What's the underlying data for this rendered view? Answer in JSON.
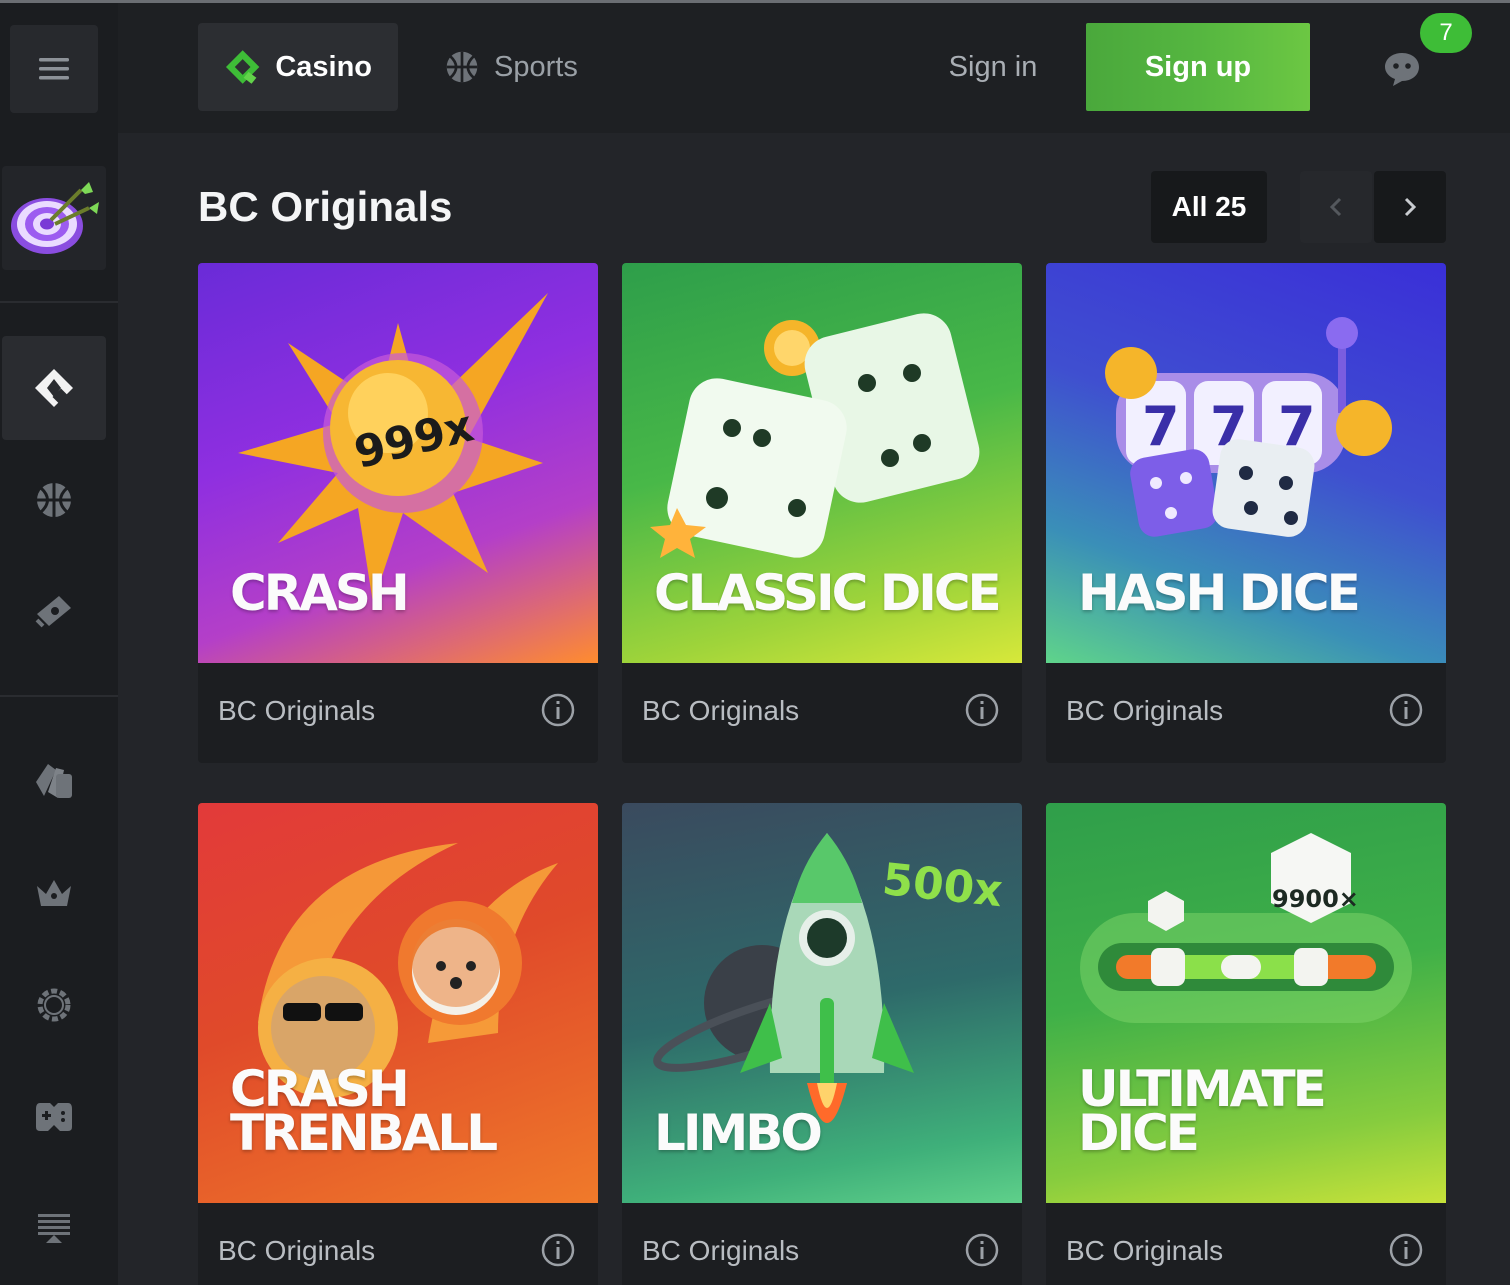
{
  "topbar": {
    "tabs": [
      {
        "label": "Casino",
        "active": true
      },
      {
        "label": "Sports",
        "active": false
      }
    ],
    "sign_in": "Sign in",
    "sign_up": "Sign up",
    "chat_badge": "7"
  },
  "sidebar": {
    "items": [
      {
        "icon": "casino-cards-icon",
        "active": true
      },
      {
        "icon": "basketball-icon",
        "active": false
      },
      {
        "icon": "ticket-icon",
        "active": false
      },
      {
        "icon": "cards-icon",
        "active": false
      },
      {
        "icon": "crown-icon",
        "active": false
      },
      {
        "icon": "gear-icon",
        "active": false
      },
      {
        "icon": "gamepad-icon",
        "active": false
      },
      {
        "icon": "podium-icon",
        "active": false
      }
    ]
  },
  "section": {
    "title": "BC Originals",
    "all_label": "All 25"
  },
  "games": [
    {
      "name": [
        "CRASH"
      ],
      "provider": "BC Originals",
      "multiplier": "999x"
    },
    {
      "name": [
        "CLASSIC DICE"
      ],
      "provider": "BC Originals"
    },
    {
      "name": [
        "HASH DICE"
      ],
      "provider": "BC Originals"
    },
    {
      "name": [
        "CRASH",
        "TRENBALL"
      ],
      "provider": "BC Originals"
    },
    {
      "name": [
        "LIMBO"
      ],
      "provider": "BC Originals",
      "multiplier": "500x"
    },
    {
      "name": [
        "ULTIMATE",
        "DICE"
      ],
      "provider": "BC Originals",
      "multiplier": "9900×"
    }
  ],
  "colors": {
    "accent_green": "#55b640",
    "badge_green": "#3ebd37",
    "background": "#232529"
  }
}
